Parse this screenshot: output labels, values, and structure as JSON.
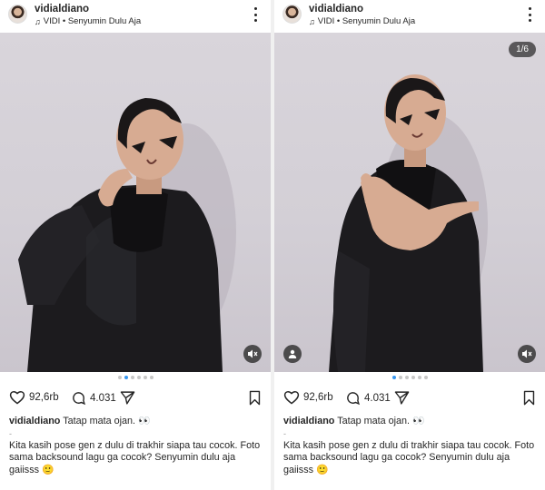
{
  "posts": [
    {
      "username": "vidialdiano",
      "music_label": "VIDI • Senyumin Dulu Aja",
      "slide_counter": "",
      "likes": "92,6rb",
      "comments": "4.031",
      "caption_user": "vidialdiano",
      "caption_title": "Tatap mata ojan. 👀",
      "caption_dash": "-",
      "caption_body": "Kita kasih pose gen z dulu di trakhir siapa tau cocok. Foto sama backsound lagu ga cocok? Senyumin dulu aja gaiisss 🙂",
      "active_dot": 1
    },
    {
      "username": "vidialdiano",
      "music_label": "VIDI • Senyumin Dulu Aja",
      "slide_counter": "1/6",
      "likes": "92,6rb",
      "comments": "4.031",
      "caption_user": "vidialdiano",
      "caption_title": "Tatap mata ojan. 👀",
      "caption_dash": "-",
      "caption_body": "Kita kasih pose gen z dulu di trakhir siapa tau cocok. Foto sama backsound lagu ga cocok? Senyumin dulu aja gaiisss 🙂",
      "active_dot": 0
    }
  ],
  "icons": {
    "like": "heart-icon",
    "comment": "comment-icon",
    "share": "send-icon",
    "save": "bookmark-icon",
    "mute": "muted-speaker-icon",
    "tags": "user-tag-icon",
    "music": "music-note-icon",
    "more": "more-vertical-icon"
  },
  "colors": {
    "accent_dot": "#3797f0",
    "inactive_dot": "#c7c7c7",
    "text": "#262626"
  }
}
